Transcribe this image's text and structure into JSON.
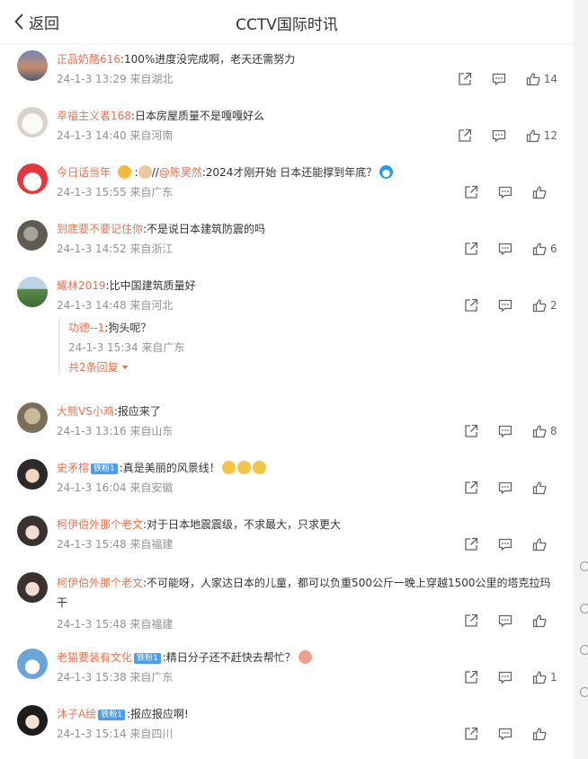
{
  "header": {
    "back_label": "返回",
    "title": "CCTV国际时讯"
  },
  "comments": [
    {
      "user": "正品奶酪616",
      "text": ":100%进度没完成啊，老天还需努力",
      "time": "24-1-3 13:29 来自湖北",
      "likes": "14"
    },
    {
      "user": "幸福主义者168",
      "text": ":日本房屋质量不是嘎嘎好么",
      "time": "24-1-3 14:40 来自河南",
      "likes": "12"
    },
    {
      "user": "今日话当年",
      "sep": ":",
      "reply_prefix": "//",
      "mention": "@陈昊然",
      "text": ":2024才刚开始 日本还能撑到年底？",
      "time": "24-1-3 15:55 来自广东",
      "likes": ""
    },
    {
      "user": "到底要不要记住你",
      "text": ":不是说日本建筑防震的吗",
      "time": "24-1-3 14:52 来自浙江",
      "likes": "6"
    },
    {
      "user": "耀林2019",
      "text": ":比中国建筑质量好",
      "time": "24-1-3 14:48 来自河北",
      "likes": "2",
      "reply": {
        "user": "功德--1",
        "text": ":狗头呢？",
        "time": "24-1-3 15:34 来自广东"
      },
      "more": "共2条回复"
    },
    {
      "user": "大熊VS小鸡",
      "text": ":报应来了",
      "time": "24-1-3 13:16 来自山东",
      "likes": "8"
    },
    {
      "user": "史矛榕",
      "badge": "铁粉1",
      "text": ":真是美丽的风景线！",
      "time": "24-1-3 16:04 来自安徽",
      "likes": ""
    },
    {
      "user": "柯伊伯外那个老文",
      "text": ":对于日本地震震级，不求最大，只求更大",
      "time": "24-1-3 15:48 来自福建",
      "likes": ""
    },
    {
      "user": "柯伊伯外那个老文",
      "text": ":不可能呀，人家达日本的儿童，都可以负重500公斤一晚上穿越1500公里的塔克拉玛干",
      "time": "24-1-3 15:48 来自福建",
      "likes": ""
    },
    {
      "user": "老猫要装有文化",
      "badge": "铁粉1",
      "text": ":精日分子还不赶快去帮忙？",
      "time": "24-1-3 15:38 来自广东",
      "likes": "1"
    },
    {
      "user": "沐子A绘",
      "badge": "铁粉1",
      "text": ":报应报应啊!",
      "time": "24-1-3 15:14 来自四川",
      "likes": ""
    }
  ],
  "colors": {
    "user": "#eb7350",
    "accent": "#ff8200",
    "badge": "#4a9cf5",
    "meta": "#939393"
  },
  "icons": [
    "back-chevron-icon",
    "share-icon",
    "comment-icon",
    "like-icon",
    "reply-toggle-icon"
  ]
}
